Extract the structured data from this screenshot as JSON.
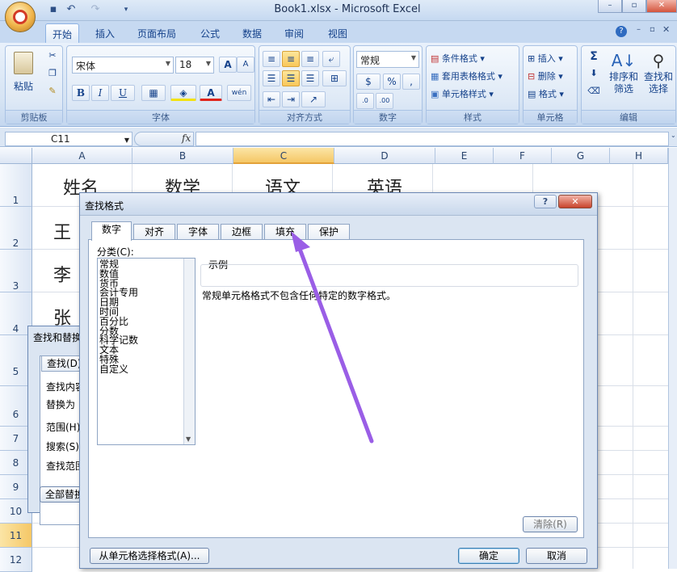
{
  "window": {
    "title": "Book1.xlsx - Microsoft Excel"
  },
  "quick_access": [
    "save-icon",
    "undo-icon",
    "redo-icon",
    "customize-icon"
  ],
  "ribbon_tabs": [
    "开始",
    "插入",
    "页面布局",
    "公式",
    "数据",
    "审阅",
    "视图"
  ],
  "ribbon": {
    "clipboard": {
      "paste": "粘贴",
      "label": "剪贴板"
    },
    "font": {
      "name": "宋体",
      "size": "18",
      "label": "字体",
      "bold": "B",
      "italic": "I",
      "underline": "U",
      "grow": "A",
      "shrink": "A",
      "color_a": "A",
      "phonetic": "wén"
    },
    "alignment": {
      "label": "对齐方式"
    },
    "number": {
      "format": "常规",
      "percent": "%",
      "comma": ",",
      "label": "数字"
    },
    "styles": {
      "conditional": "条件格式",
      "table": "套用表格格式",
      "cell": "单元格样式",
      "label": "样式"
    },
    "cells": {
      "insert": "插入",
      "delete": "删除",
      "format": "格式",
      "label": "单元格"
    },
    "editing": {
      "sigma": "Σ",
      "sort": "排序和\n筛选",
      "find": "查找和\n选择",
      "label": "编辑"
    }
  },
  "formula_bar": {
    "name_box": "C11",
    "fx": "fx"
  },
  "columns": [
    "A",
    "B",
    "C",
    "D",
    "E",
    "F",
    "G",
    "H"
  ],
  "rows": [
    "1",
    "2",
    "3",
    "4",
    "5",
    "6",
    "7",
    "8",
    "9",
    "10",
    "11",
    "12"
  ],
  "cells": {
    "A1": "姓名",
    "B1": "数学",
    "C1": "语文",
    "D1": "英语",
    "A2": "王",
    "A3": "李",
    "A4": "张"
  },
  "find_replace": {
    "title": "查找和替换",
    "tab_find": "查找(D)",
    "find_what": "查找内容",
    "replace_with": "替换为",
    "within": "范围(H)",
    "search": "搜索(S)",
    "look_in": "查找范围",
    "replace_all": "全部替换"
  },
  "dialog": {
    "title": "查找格式",
    "help": "?",
    "close": "✕",
    "tabs": [
      "数字",
      "对齐",
      "字体",
      "边框",
      "填充",
      "保护"
    ],
    "category_label": "分类(C):",
    "categories": [
      "常规",
      "数值",
      "货币",
      "会计专用",
      "日期",
      "时间",
      "百分比",
      "分数",
      "科学记数",
      "文本",
      "特殊",
      "自定义"
    ],
    "sample_label": "示例",
    "description": "常规单元格格式不包含任何特定的数字格式。",
    "clear": "清除(R)",
    "pick_from_cell": "从单元格选择格式(A)...",
    "ok": "确定",
    "cancel": "取消"
  },
  "colors": {
    "accent_annotation": "#9a5ee6",
    "header_selected": "#f9d37a"
  }
}
